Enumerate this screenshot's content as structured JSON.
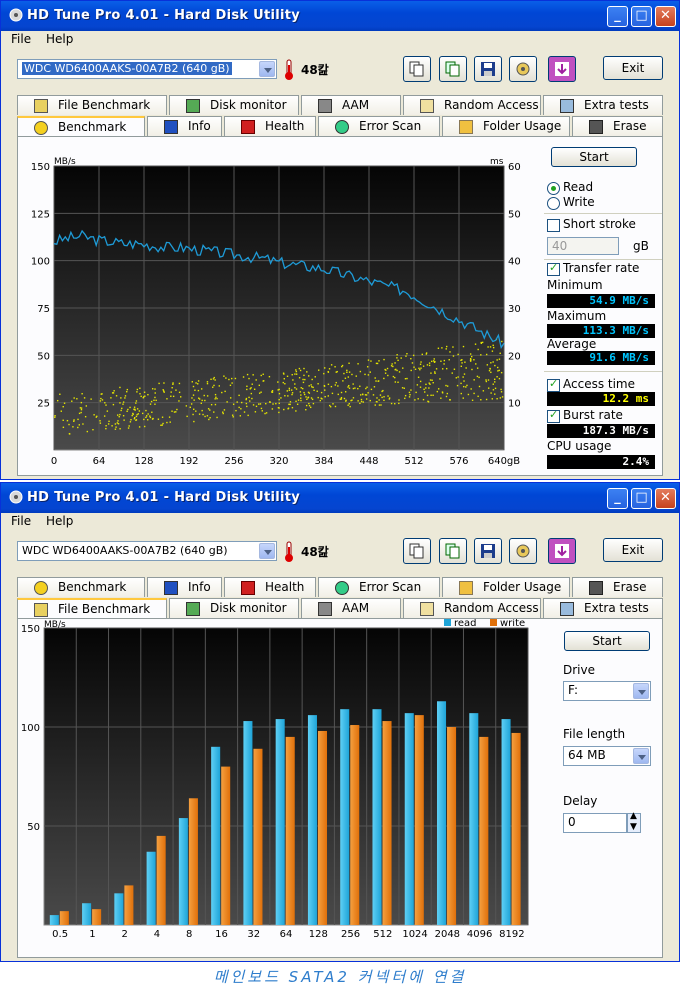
{
  "app": {
    "title": "HD Tune Pro 4.01 - Hard Disk Utility",
    "menu": [
      "File",
      "Help"
    ],
    "drive": "WDC WD6400AAKS-00A7B2 (640 gB)",
    "temperature": "48캂",
    "exit_label": "Exit",
    "tabs_row_a": [
      "File Benchmark",
      "Disk monitor",
      "AAM",
      "Random Access",
      "Extra tests"
    ],
    "tabs_row_b": [
      "Benchmark",
      "Info",
      "Health",
      "Error Scan",
      "Folder Usage",
      "Erase"
    ]
  },
  "benchmark": {
    "start_label": "Start",
    "read_label": "Read",
    "write_label": "Write",
    "read_selected": true,
    "short_stroke_label": "Short stroke",
    "short_stroke_value": "40",
    "short_stroke_unit": "gB",
    "transfer_rate_label": "Transfer rate",
    "minimum_label": "Minimum",
    "minimum_value": "54.9 MB/s",
    "maximum_label": "Maximum",
    "maximum_value": "113.3 MB/s",
    "average_label": "Average",
    "average_value": "91.6 MB/s",
    "access_time_label": "Access time",
    "access_time_value": "12.2 ms",
    "burst_rate_label": "Burst rate",
    "burst_rate_value": "187.3 MB/s",
    "cpu_usage_label": "CPU usage",
    "cpu_usage_value": "2.4%"
  },
  "file_benchmark": {
    "start_label": "Start",
    "drive_label": "Drive",
    "drive_value": "F:",
    "file_length_label": "File length",
    "file_length_value": "64 MB",
    "delay_label": "Delay",
    "delay_value": "0"
  },
  "caption": "메인보드 SATA2 커넥터에 연결",
  "colors": {
    "read_line": "#1e9bd7",
    "access_dots": "#e6e600",
    "read_bar": "#1ea4d8",
    "write_bar": "#e0700a"
  },
  "chart_data": [
    {
      "type": "line",
      "ylabel_left": "MB/s",
      "ylabel_right": "ms",
      "ylim_left": [
        0,
        150
      ],
      "ylim_right": [
        0,
        60
      ],
      "y_ticks_left": [
        "150",
        "125",
        "100",
        "75",
        "50",
        "25"
      ],
      "y_ticks_right": [
        "60",
        "50",
        "40",
        "30",
        "20",
        "10"
      ],
      "x_ticks": [
        "0",
        "64",
        "128",
        "192",
        "256",
        "320",
        "384",
        "448",
        "512",
        "576",
        "640gB"
      ],
      "xlim": [
        0,
        640
      ],
      "series": [
        {
          "name": "Transfer rate",
          "x": [
            0,
            20,
            40,
            60,
            80,
            100,
            120,
            140,
            160,
            180,
            200,
            220,
            240,
            260,
            280,
            300,
            320,
            340,
            360,
            380,
            400,
            420,
            440,
            460,
            480,
            500,
            520,
            540,
            560,
            580,
            600,
            620,
            640
          ],
          "values": [
            110,
            112,
            113,
            111,
            110,
            109,
            109,
            108,
            107,
            107,
            106,
            105,
            104,
            103,
            102,
            101,
            99,
            98,
            97,
            96,
            94,
            92,
            90,
            88,
            86,
            84,
            80,
            76,
            72,
            68,
            64,
            60,
            56
          ]
        }
      ],
      "scatter_ms_range_by_x": {
        "x": [
          0,
          128,
          256,
          384,
          512,
          640
        ],
        "low": [
          3,
          5,
          7,
          9,
          10,
          11
        ],
        "high": [
          12,
          14,
          16,
          18,
          21,
          24
        ]
      }
    },
    {
      "type": "bar",
      "ylabel": "MB/s",
      "ylim": [
        0,
        150
      ],
      "y_ticks": [
        "150",
        "100",
        "50"
      ],
      "legend": "top-right",
      "categories": [
        "0.5",
        "1",
        "2",
        "4",
        "8",
        "16",
        "32",
        "64",
        "128",
        "256",
        "512",
        "1024",
        "2048",
        "4096",
        "8192"
      ],
      "series": [
        {
          "name": "read",
          "values": [
            5,
            11,
            16,
            37,
            54,
            90,
            103,
            104,
            106,
            109,
            109,
            107,
            113,
            107,
            104
          ]
        },
        {
          "name": "write",
          "values": [
            7,
            8,
            20,
            45,
            64,
            80,
            89,
            95,
            98,
            101,
            103,
            106,
            100,
            95,
            97
          ]
        }
      ]
    }
  ]
}
